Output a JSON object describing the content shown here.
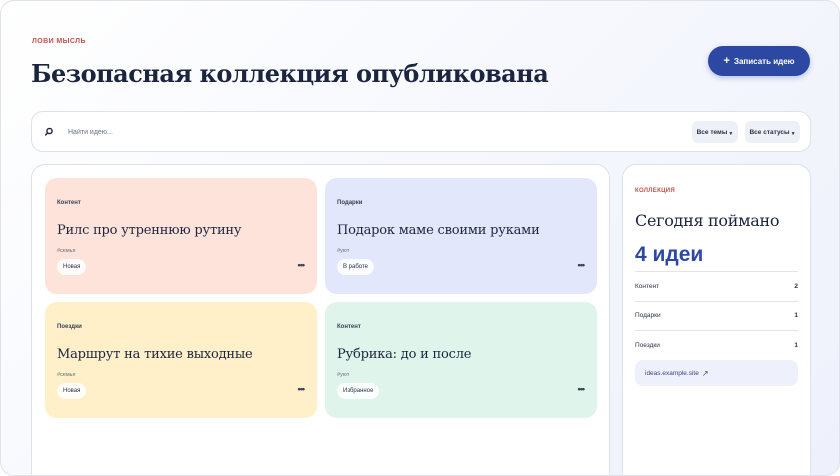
{
  "header": {
    "eyebrow": "ЛОВИ МЫСЛЬ",
    "title": "Безопасная коллекция опубликована",
    "new_button_label": "Записать идею"
  },
  "search": {
    "placeholder": "Найти идею...",
    "value": "",
    "filter_topics": "Все темы",
    "filter_statuses": "Все статусы"
  },
  "cards": [
    {
      "tag": "Контент",
      "title": "Рилс про утреннюю рутину",
      "hashtag": "#семья",
      "status": "Новая"
    },
    {
      "tag": "Подарки",
      "title": "Подарок маме своими руками",
      "hashtag": "#уют",
      "status": "В работе"
    },
    {
      "tag": "Поездки",
      "title": "Маршрут на тихие выходные",
      "hashtag": "#семья",
      "status": "Новая"
    },
    {
      "tag": "Контент",
      "title": "Рубрика: до и после",
      "hashtag": "#уют",
      "status": "Избранное"
    }
  ],
  "summary": {
    "eyebrow": "КОЛЛЕКЦИЯ",
    "title": "Сегодня поймано",
    "count": "4 идеи",
    "rows": [
      {
        "label": "Контент",
        "count": "2"
      },
      {
        "label": "Подарки",
        "count": "1"
      },
      {
        "label": "Поездки",
        "count": "1"
      }
    ],
    "link": "ideas.example.site"
  },
  "colors": {
    "accent": "#2c48a3",
    "eyebrow": "#c0524a",
    "card_content": "#fde3da",
    "card_gifts": "#e2e7fc",
    "card_trips": "#fff0c9",
    "card_content_alt": "#dff4ea"
  },
  "icons": {
    "new_button": "plus-icon",
    "search": "search-icon",
    "filter": "chevron-down-icon",
    "card_menu": "more-icon",
    "link": "external-link-icon"
  }
}
